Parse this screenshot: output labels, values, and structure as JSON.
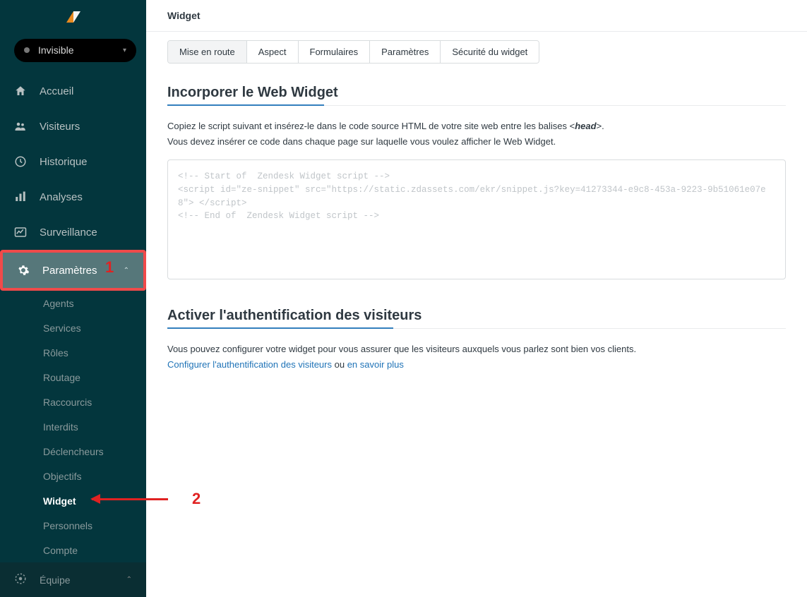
{
  "status": {
    "label": "Invisible"
  },
  "nav": {
    "accueil": "Accueil",
    "visiteurs": "Visiteurs",
    "historique": "Historique",
    "analyses": "Analyses",
    "surveillance": "Surveillance",
    "parametres": "Paramètres",
    "equipe": "Équipe"
  },
  "subnav": {
    "agents": "Agents",
    "services": "Services",
    "roles": "Rôles",
    "routage": "Routage",
    "raccourcis": "Raccourcis",
    "interdits": "Interdits",
    "declencheurs": "Déclencheurs",
    "objectifs": "Objectifs",
    "widget": "Widget",
    "personnels": "Personnels",
    "compte": "Compte"
  },
  "page": {
    "title": "Widget"
  },
  "tabs": {
    "mise_en_route": "Mise en route",
    "aspect": "Aspect",
    "formulaires": "Formulaires",
    "parametres": "Paramètres",
    "securite": "Sécurité du widget"
  },
  "embed": {
    "heading": "Incorporer le Web Widget",
    "p1_prefix": "Copiez le script suivant et insérez-le dans le code source HTML de votre site web entre les balises <",
    "p1_head": "head",
    "p1_suffix": ">.",
    "p2": "Vous devez insérer ce code dans chaque page sur laquelle vous voulez afficher le Web Widget.",
    "code": "<!-- Start of  Zendesk Widget script -->\n<script id=\"ze-snippet\" src=\"https://static.zdassets.com/ekr/snippet.js?key=41273344-e9c8-453a-9223-9b51061e07e8\"> </script>\n<!-- End of  Zendesk Widget script -->"
  },
  "auth": {
    "heading": "Activer l'authentification des visiteurs",
    "p1": "Vous pouvez configurer votre widget pour vous assurer que les visiteurs auxquels vous parlez sont bien vos clients.",
    "link1": "Configurer l'authentification des visiteurs",
    "mid": " ou ",
    "link2": "en savoir plus"
  },
  "annot": {
    "one": "1",
    "two": "2"
  }
}
